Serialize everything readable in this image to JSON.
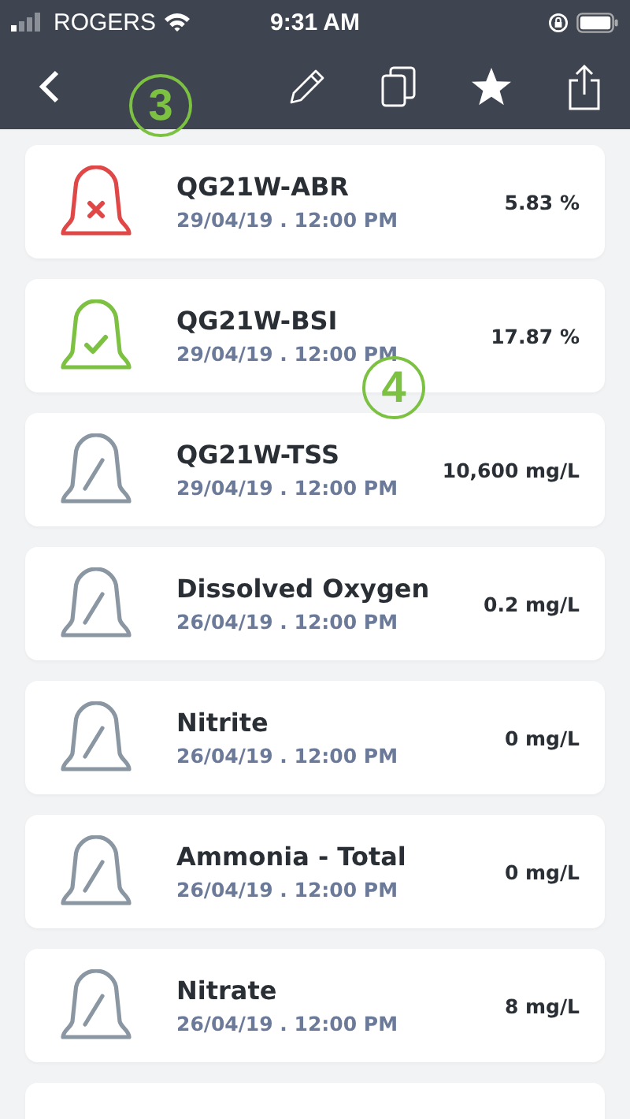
{
  "status_bar": {
    "carrier": "ROGERS",
    "time": "9:31 AM"
  },
  "toolbar": {
    "buttons": [
      {
        "kind": "back"
      },
      {
        "kind": "edit"
      },
      {
        "kind": "copy"
      },
      {
        "kind": "favorite"
      },
      {
        "kind": "share"
      }
    ]
  },
  "annotations": [
    {
      "label": "3"
    },
    {
      "label": "4"
    }
  ],
  "items": [
    {
      "name": "QG21W-ABR",
      "date": "29/04/19 . 12:00 PM",
      "value": "5.83 %",
      "kind": "alarm"
    },
    {
      "name": "QG21W-BSI",
      "date": "29/04/19 . 12:00 PM",
      "value": "17.87 %",
      "kind": "ok"
    },
    {
      "name": "QG21W-TSS",
      "date": "29/04/19 . 12:00 PM",
      "value": "10,600 mg/L",
      "kind": "neutral"
    },
    {
      "name": "Dissolved Oxygen",
      "date": "26/04/19 . 12:00 PM",
      "value": "0.2 mg/L",
      "kind": "neutral"
    },
    {
      "name": "Nitrite",
      "date": "26/04/19 . 12:00 PM",
      "value": "0 mg/L",
      "kind": "neutral"
    },
    {
      "name": "Ammonia - Total",
      "date": "26/04/19 . 12:00 PM",
      "value": "0 mg/L",
      "kind": "neutral"
    },
    {
      "name": "Nitrate",
      "date": "26/04/19 . 12:00 PM",
      "value": "8 mg/L",
      "kind": "neutral"
    }
  ]
}
